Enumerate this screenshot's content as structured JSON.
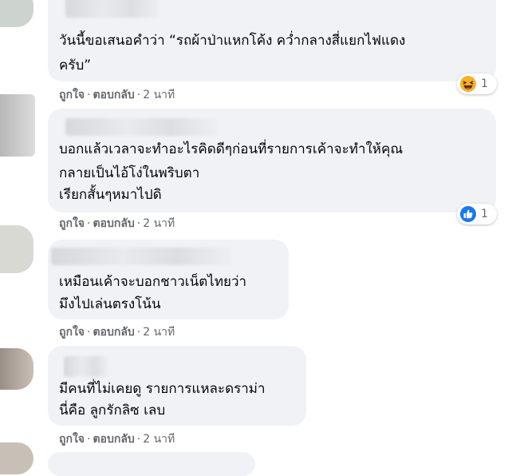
{
  "comments": [
    {
      "lines": [
        "วันนี้ขอเสนอคำว่า “รถผ้าป่าแหกโค้ง คว่ำกลางสี่แยกไฟแดง",
        "ครับ”"
      ],
      "like": "ถูกใจ",
      "reply": "ตอบกลับ",
      "time": "2 นาที",
      "reaction": {
        "icon": "haha-icon",
        "count": "1"
      }
    },
    {
      "lines": [
        "บอกแล้วเวลาจะทำอะไรคิดดีๆก่อนที่รายการเค้าจะทำให้คุณ",
        "กลายเป็นไอ้โง่ในพริบตา",
        "เรียกสั้นๆหมาไปดิ"
      ],
      "like": "ถูกใจ",
      "reply": "ตอบกลับ",
      "time": "2 นาที",
      "reaction": {
        "icon": "like-icon",
        "count": "1"
      }
    },
    {
      "lines": [
        "เหมือนเค้าจะบอกชาวเน็ตไทยว่า",
        "มึงไปเล่นตรงโน้น"
      ],
      "like": "ถูกใจ",
      "reply": "ตอบกลับ",
      "time": "2 นาที"
    },
    {
      "lines": [
        "มีคนที่ไม่เคยดู รายการแหละดราม่า",
        "นี่คือ ลูกรักลิซ เลบ"
      ],
      "like": "ถูกใจ",
      "reply": "ตอบกลับ",
      "time": "2 นาที"
    }
  ],
  "colors": {
    "bubble": "#f0f2f5",
    "meta_text": "#65676b",
    "like_blue": "#1877f2",
    "haha_yellow": "#f7b125"
  }
}
